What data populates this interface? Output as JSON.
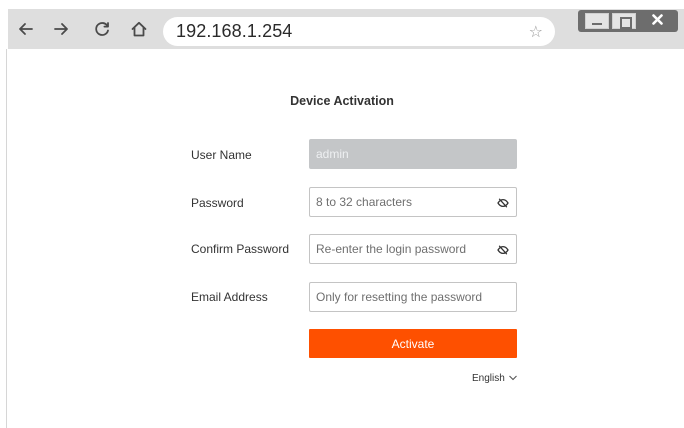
{
  "browser": {
    "url": "192.168.1.254",
    "icons": {
      "back": "arrow-left-icon",
      "forward": "arrow-right-icon",
      "reload": "reload-icon",
      "home": "home-icon",
      "bookmark": "star-icon",
      "minimize": "minimize-icon",
      "maximize": "maximize-icon",
      "close": "close-icon"
    }
  },
  "form": {
    "title": "Device Activation",
    "username": {
      "label": "User Name",
      "value": "admin"
    },
    "password": {
      "label": "Password",
      "value": "",
      "placeholder": "8 to 32 characters"
    },
    "confirm_password": {
      "label": "Confirm Password",
      "value": "",
      "placeholder": "Re-enter the login password"
    },
    "email": {
      "label": "Email Address",
      "value": "",
      "placeholder": "Only for resetting the password"
    },
    "activate_label": "Activate",
    "language": "English"
  },
  "colors": {
    "accent": "#fe5000",
    "disabled_field": "#c4c6c8",
    "chrome": "#dedede"
  }
}
